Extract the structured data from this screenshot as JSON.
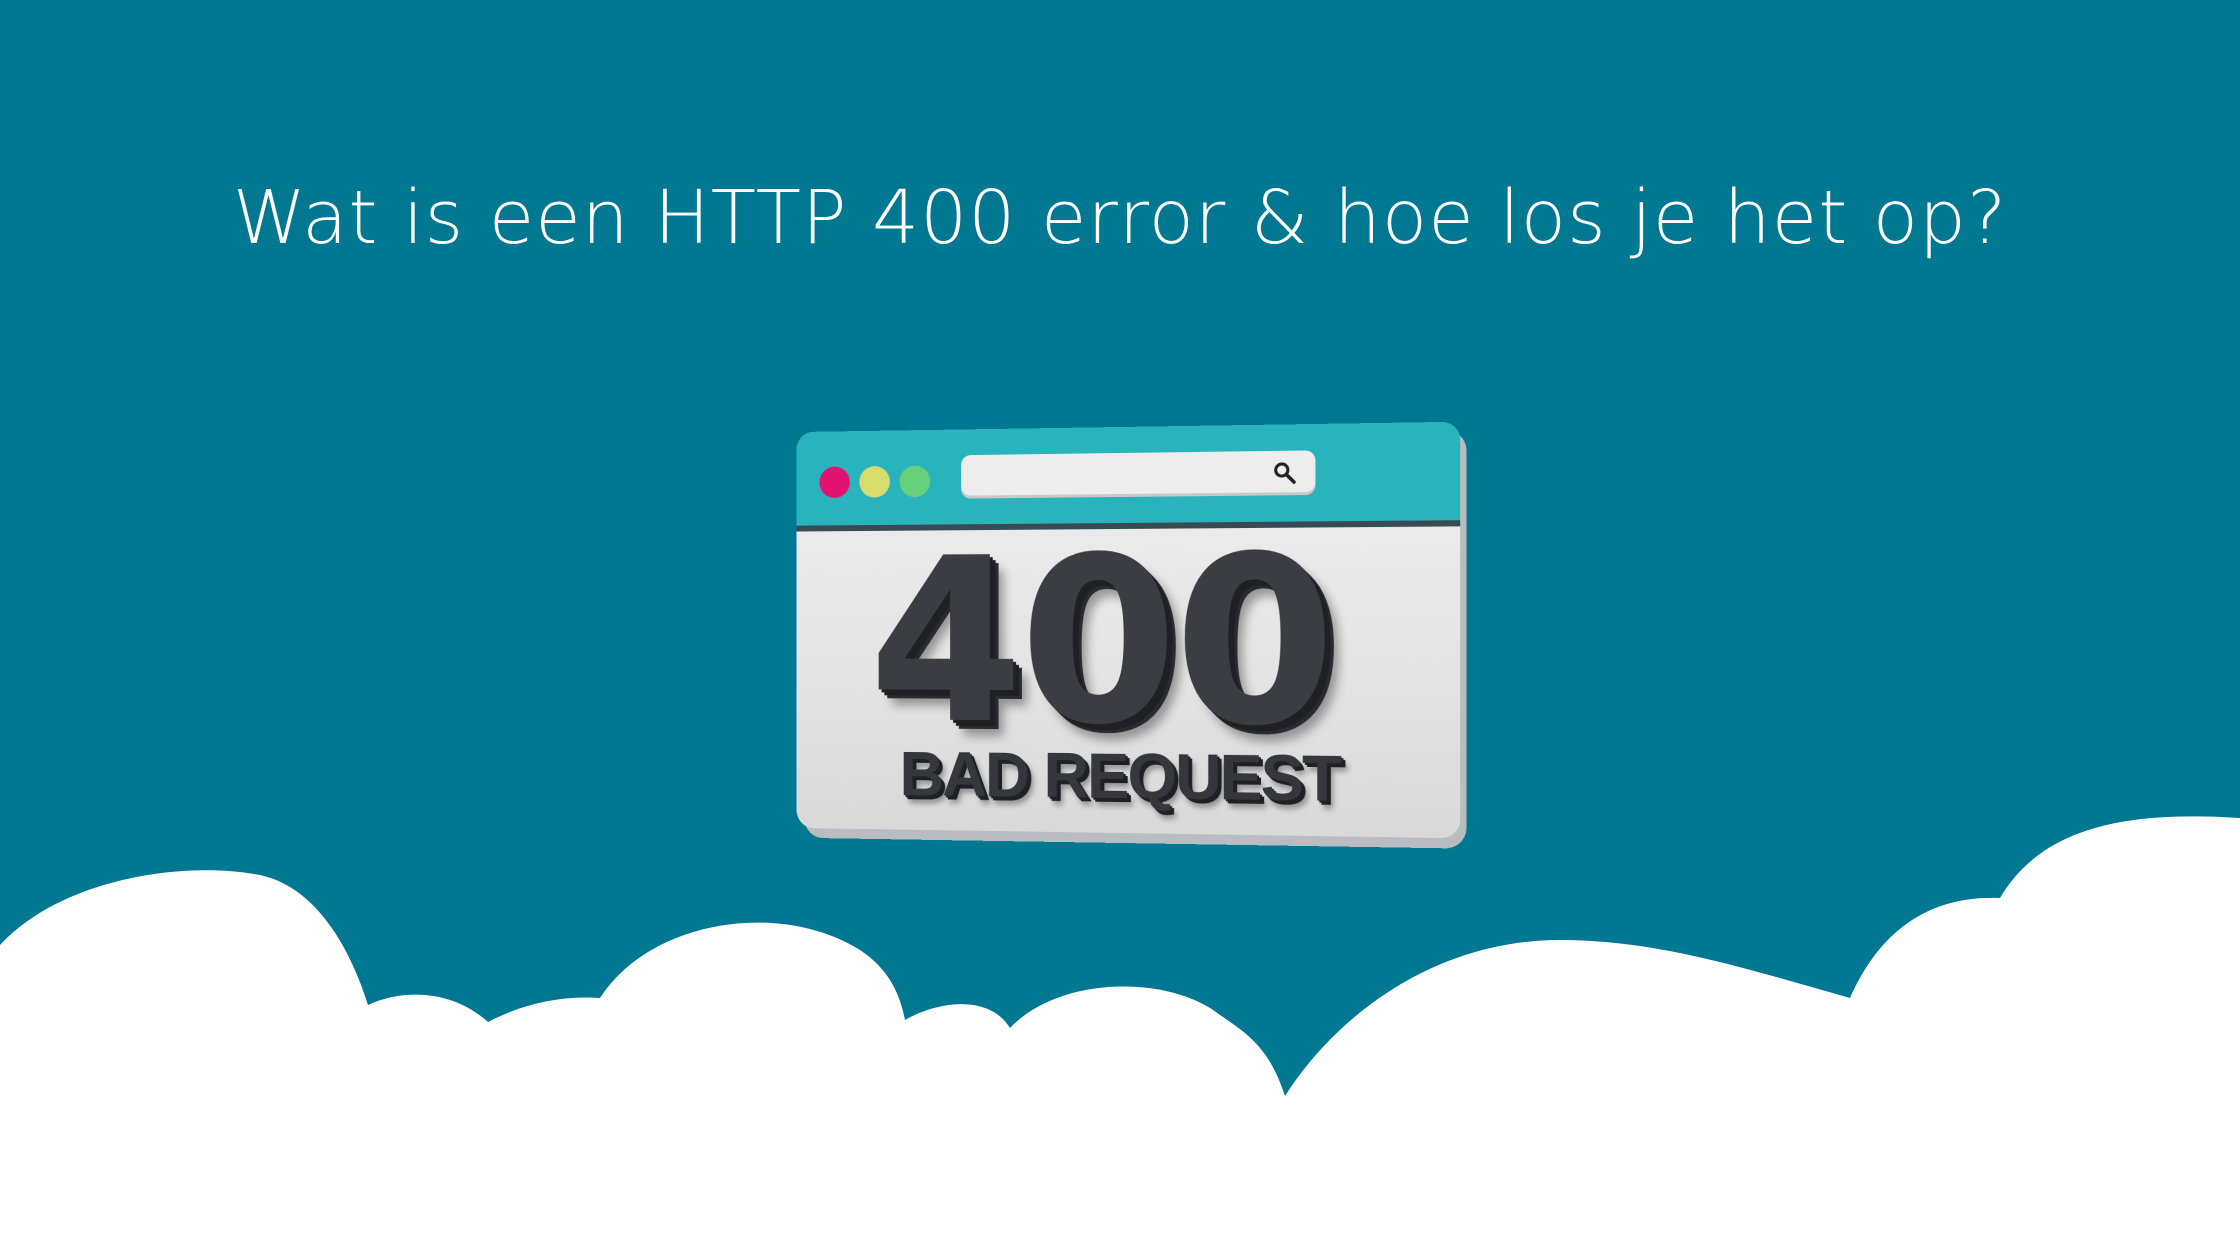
{
  "headline": "Wat is een HTTP 400 error & hoe los je het op?",
  "illustration": {
    "status_code": "400",
    "status_text": "BAD REQUEST",
    "window_dots": [
      "#e3126f",
      "#d8dc6a",
      "#66d07a"
    ],
    "icons": [
      "search-icon"
    ]
  },
  "colors": {
    "background": "#007891",
    "text": "#ffffff",
    "browser_bar": "#29b3bc",
    "clouds": "#ffffff"
  }
}
